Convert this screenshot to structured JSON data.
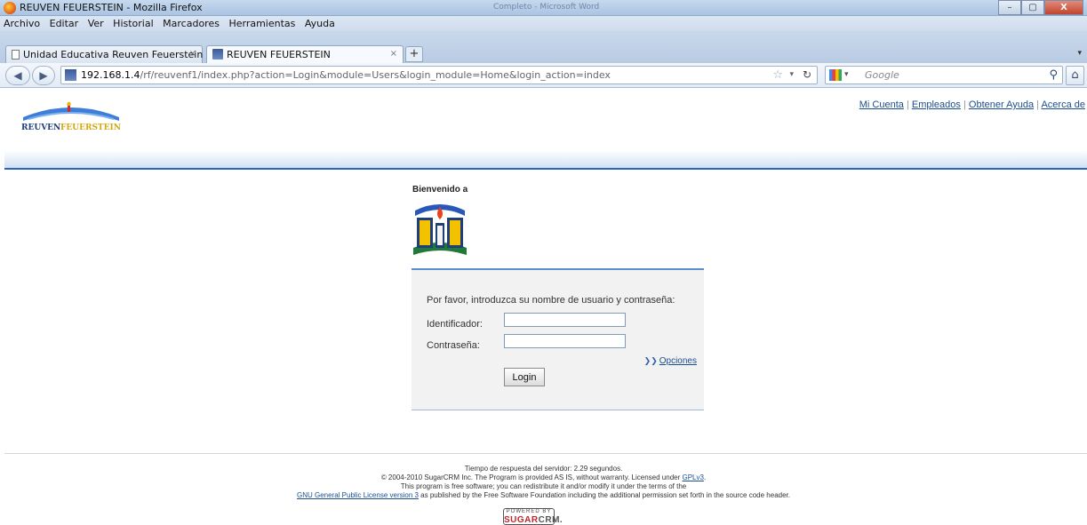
{
  "window": {
    "title": "REUVEN FEUERSTEIN - Mozilla Firefox",
    "background_window_title": "Completo - Microsoft Word",
    "controls": [
      "–",
      "▢",
      "X"
    ]
  },
  "menu": [
    "Archivo",
    "Editar",
    "Ver",
    "Historial",
    "Marcadores",
    "Herramientas",
    "Ayuda"
  ],
  "tabs": [
    {
      "label": "Unidad Educativa Reuven Feuerstein",
      "active": false,
      "close": "×"
    },
    {
      "label": "REUVEN FEUERSTEIN",
      "active": true,
      "close": "×"
    }
  ],
  "newtab_label": "+",
  "nav": {
    "back": "◀",
    "forward": "▶",
    "url_host": "192.168.1.4",
    "url_path": "/rf/reuvenf1/index.php?action=Login&module=Users&login_module=Home&login_action=index",
    "search_placeholder": "Google",
    "home": "⌂"
  },
  "page": {
    "logo_text": "REUVEN FEUERSTEIN",
    "top_links": [
      "Mi Cuenta",
      "Empleados",
      "Obtener Ayuda",
      "Acerca de"
    ],
    "separator": "|",
    "welcome": "Bienvenido a",
    "login": {
      "prompt": "Por favor, introduzca su nombre de usuario y contraseña:",
      "user_label": "Identificador:",
      "user_value": "",
      "pass_label": "Contraseña:",
      "pass_value": "",
      "options_link": "Opciones",
      "login_button": "Login"
    },
    "footer": {
      "response_time": "Tiempo de respuesta del servidor: 2.29 segundos.",
      "copyright_pre": "© 2004-2010 SugarCRM Inc. The Program is provided AS IS, without warranty. Licensed under ",
      "gpl_link": "GPLv3",
      "copyright_post": ".",
      "free_software": "This program is free software; you can redistribute it and/or modify it under the terms of the",
      "gnu_link": "GNU General Public License version 3",
      "gnu_post": " as published by the Free Software Foundation including the additional permission set forth in the source code header.",
      "powered_by": "POWERED BY",
      "sugar_red": "SUGAR",
      "sugar_grey": "CRM."
    }
  },
  "colors": {
    "link": "#1b4e8f",
    "header_rule": "#2c64b8",
    "login_box_bg": "#f2f2f2",
    "sugar_red": "#c0262d"
  }
}
